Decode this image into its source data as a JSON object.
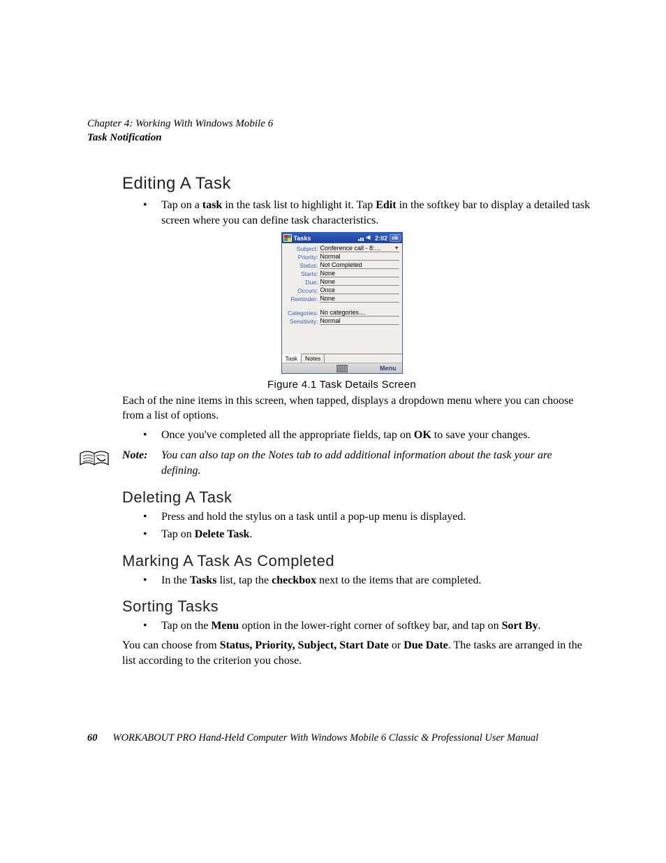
{
  "header": {
    "chapter": "Chapter 4: Working With Windows Mobile 6",
    "section": "Task Notification"
  },
  "s1": {
    "title": "Editing A Task",
    "b1a": "Tap on a ",
    "b1b": "task",
    "b1c": " in the task list to highlight it. Tap ",
    "b1d": "Edit",
    "b1e": " in the softkey bar to display a detailed task screen where you can define task characteristics.",
    "caption": "Figure 4.1 Task Details Screen",
    "p1": "Each of the nine items in this screen, when tapped, displays a dropdown menu where you can choose from a list of options.",
    "b2a": "Once you've completed all the appropriate fields, tap on ",
    "b2b": "OK",
    "b2c": " to save your changes."
  },
  "note": {
    "label": "Note:",
    "text": "You can also tap on the Notes tab to add additional information about the task your are defining."
  },
  "s2": {
    "title": "Deleting A Task",
    "b1": "Press and hold the stylus on a task until a pop-up menu is displayed.",
    "b2a": "Tap on ",
    "b2b": "Delete Task",
    "b2c": "."
  },
  "s3": {
    "title": "Marking A Task As Completed",
    "b1a": "In the ",
    "b1b": "Tasks",
    "b1c": " list, tap the ",
    "b1d": "checkbox",
    "b1e": " next to the items that are completed."
  },
  "s4": {
    "title": "Sorting Tasks",
    "b1a": "Tap on the ",
    "b1b": "Menu",
    "b1c": " option in the lower-right corner of softkey bar, and tap on ",
    "b1d": "Sort By",
    "b1e": ".",
    "p1a": "You can choose from ",
    "p1b": "Status, Priority, Subject, Start Date",
    "p1c": " or ",
    "p1d": "Due Date",
    "p1e": ". The tasks are arranged in the list according to the criterion you chose."
  },
  "screenshot": {
    "title": "Tasks",
    "time": "2:02",
    "ok": "ok",
    "tab1": "Task",
    "tab2": "Notes",
    "menu": "Menu",
    "fields": {
      "subject_l": "Subject:",
      "subject_v": "Conference call - 8:…",
      "priority_l": "Priority:",
      "priority_v": "Normal",
      "status_l": "Status:",
      "status_v": "Not Completed",
      "starts_l": "Starts:",
      "starts_v": "None",
      "due_l": "Due:",
      "due_v": "None",
      "occurs_l": "Occurs:",
      "occurs_v": "Once",
      "reminder_l": "Reminder:",
      "reminder_v": "None",
      "categories_l": "Categories:",
      "categories_v": "No categories…",
      "sensitivity_l": "Sensitivity:",
      "sensitivity_v": "Normal"
    }
  },
  "footer": {
    "page": "60",
    "text": "WORKABOUT PRO Hand-Held Computer With Windows Mobile 6 Classic & Professional User Manual"
  }
}
